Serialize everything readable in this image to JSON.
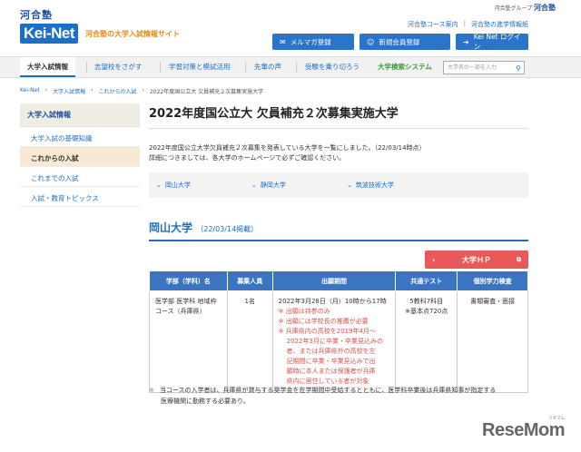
{
  "header": {
    "logo_kawai": "河合塾",
    "logo_kei": "Kei-Net",
    "tagline": "河合塾の大学入試情報サイト",
    "group_label": "河合塾グループ",
    "group_name": "河合塾",
    "links": [
      "河合塾コース案内",
      "河合塾の進学情報紙"
    ],
    "buttons": [
      {
        "icon": "mail-icon",
        "label": "メルマガ登録"
      },
      {
        "icon": "user-icon",
        "label": "新規会員登録"
      },
      {
        "icon": "login-icon",
        "label": "Kei Net ログイン"
      }
    ]
  },
  "nav": {
    "items": [
      "大学入試情報",
      "志望校をさがす",
      "学習対策と模試活用",
      "先輩の声",
      "受験を乗り切ろう",
      "大学検索システム"
    ],
    "search_placeholder": "大学名の一部を入力"
  },
  "breadcrumb": [
    "Kei-Net",
    "大学入試情報",
    "これからの入試",
    "2022年度国公立大 欠員補充２次募集実施大学"
  ],
  "sidebar": {
    "heading": "大学入試情報",
    "items": [
      "大学入試の基礎知識",
      "これからの入試",
      "これまでの入試",
      "入試・教育トピックス"
    ]
  },
  "main": {
    "title": "2022年度国公立大 欠員補充２次募集実施大学",
    "intro_line1": "2022年度国公立大学欠員補充２次募集を発表している大学を一覧にしました。（22/03/14時点）",
    "intro_line2": "詳細につきましては、各大学のホームページで必ずご確認ください。",
    "anchors": [
      "岡山大学",
      "静岡大学",
      "筑波技術大学"
    ]
  },
  "university": {
    "name": "岡山大学",
    "date": "（22/03/14掲載）",
    "hp_button": "大学ＨＰ",
    "columns": [
      "学部（学科）名",
      "募集人員",
      "出願期間",
      "共通テスト",
      "個別学力検査"
    ],
    "row": {
      "dept_line1": "医学部 医学科 地域枠",
      "dept_line2": "コース（兵庫県）",
      "capacity": "1名",
      "period": "2022年3月28日（月）10時から17時",
      "notes": [
        "出願は持参のみ",
        "出願には学校長の推薦が必要",
        "兵庫県内の高校を2019年4月〜",
        "2022年3月に卒業・卒業見込みの",
        "者、または兵庫県外の高校を左",
        "記期間に卒業・卒業見込みで出",
        "願時に本人または保護者が兵庫",
        "県内に居住している者が対象"
      ],
      "test_line1": "5教科7科目",
      "test_line2": "※基本点720点",
      "individual": "書類審査・面接"
    }
  },
  "footnote": {
    "mark": "※",
    "line1": "当コースの入学者は、兵庫県が貸与する奨学金を在学期間中受給するとともに、医学科卒業後は兵庫県知事が指定する",
    "line2": "医療機関に勤務する必要あり。"
  },
  "watermark": {
    "text": "ReseMom",
    "sub": "リセマム"
  }
}
